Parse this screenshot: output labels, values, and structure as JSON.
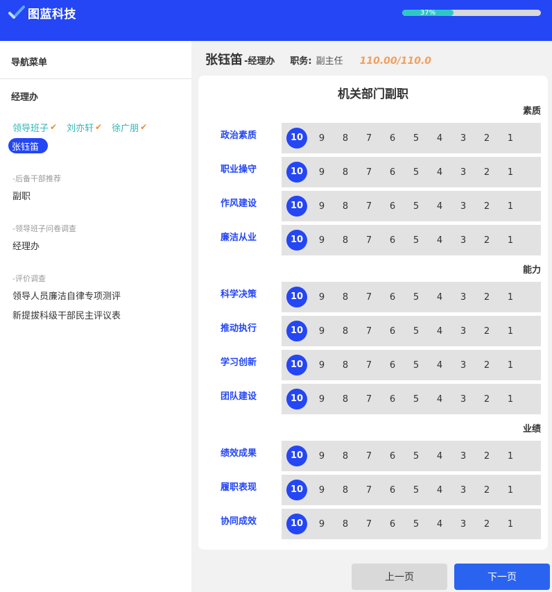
{
  "header": {
    "brand_name": "图蓝科技",
    "progress_value": 37,
    "progress_label": "37%"
  },
  "sidebar": {
    "nav_title": "导航菜单",
    "dept_title": "经理办",
    "people": [
      {
        "name": "领导班子",
        "checked": true,
        "active": false
      },
      {
        "name": "刘亦轩",
        "checked": true,
        "active": false
      },
      {
        "name": "徐广朋",
        "checked": true,
        "active": false
      },
      {
        "name": "张钰笛",
        "checked": false,
        "active": true
      }
    ],
    "sections": [
      {
        "head": "-后备干部推荐",
        "items": [
          "副职"
        ]
      },
      {
        "head": "-领导班子问卷调查",
        "items": [
          "经理办"
        ]
      },
      {
        "head": "-评价调查",
        "items": [
          "领导人员廉洁自律专项测评",
          "新提拔科级干部民主评议表"
        ]
      }
    ]
  },
  "employee": {
    "name": "张钰笛",
    "dept": "-经理办",
    "role_label": "职务:",
    "role": "副主任",
    "score": "110.00/110.0"
  },
  "form": {
    "title": "机关部门副职",
    "scale": [
      "10",
      "9",
      "8",
      "7",
      "6",
      "5",
      "4",
      "3",
      "2",
      "1"
    ],
    "groups": [
      {
        "title": "素质",
        "rows": [
          {
            "label": "政治素质",
            "selected": "10"
          },
          {
            "label": "职业操守",
            "selected": "10"
          },
          {
            "label": "作风建设",
            "selected": "10"
          },
          {
            "label": "廉洁从业",
            "selected": "10"
          }
        ]
      },
      {
        "title": "能力",
        "rows": [
          {
            "label": "科学决策",
            "selected": "10"
          },
          {
            "label": "推动执行",
            "selected": "10"
          },
          {
            "label": "学习创新",
            "selected": "10"
          },
          {
            "label": "团队建设",
            "selected": "10"
          }
        ]
      },
      {
        "title": "业绩",
        "rows": [
          {
            "label": "绩效成果",
            "selected": "10"
          },
          {
            "label": "履职表现",
            "selected": "10"
          },
          {
            "label": "协同成效",
            "selected": "10"
          }
        ]
      }
    ]
  },
  "footer": {
    "prev_label": "上一页",
    "next_label": "下一页"
  },
  "colors": {
    "primary": "#2446f4",
    "teal": "#2fc7c5",
    "check": "#f08a2c",
    "score": "#f0a060"
  }
}
